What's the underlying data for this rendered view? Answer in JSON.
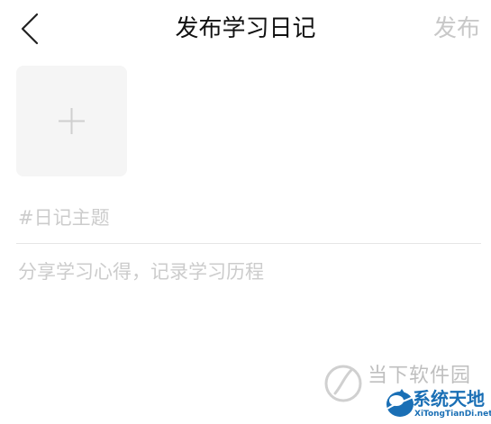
{
  "header": {
    "title": "发布学习日记",
    "publish_label": "发布",
    "back_icon": "chevron-left-icon"
  },
  "photo": {
    "add_icon": "plus-icon"
  },
  "form": {
    "topic_placeholder": "#日记主题",
    "topic_value": "",
    "content_placeholder": "分享学习心得，记录学习历程",
    "content_value": ""
  },
  "watermark": {
    "left_text": "当下软件园",
    "right_brand": "系统天地",
    "right_sub": "XiTongTianDi.net"
  },
  "colors": {
    "title": "#111111",
    "publish_disabled": "#c8c8c8",
    "placeholder": "#cccccc",
    "photo_bg": "#f5f5f5",
    "divider": "#e6e6e6",
    "watermark_blue": "#1a6fb5"
  }
}
